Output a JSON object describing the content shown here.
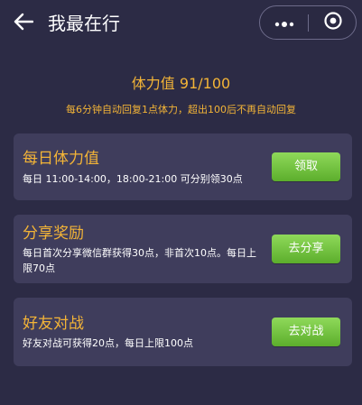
{
  "header": {
    "title": "我最在行",
    "back_icon": "arrow-left-icon",
    "more_icon": "more-dots-icon",
    "close_icon": "target-circle-icon"
  },
  "stamina": {
    "label": "体力值 91/100",
    "value": 91,
    "max": 100,
    "note": "每6分钟自动回复1点体力，超出100后不再自动回复"
  },
  "cards": [
    {
      "title": "每日体力值",
      "desc": "每日 11:00-14:00，18:00-21:00 可分别领30点",
      "button": "领取"
    },
    {
      "title": "分享奖励",
      "desc": "每日首次分享微信群获得30点，非首次10点。每日上限70点",
      "button": "去分享"
    },
    {
      "title": "好友对战",
      "desc": "好友对战可获得20点，每日上限100点",
      "button": "去对战"
    }
  ],
  "colors": {
    "background": "#2c2b45",
    "card": "#3f3d5c",
    "accent": "#f3b437",
    "button": "#6cc23a"
  }
}
